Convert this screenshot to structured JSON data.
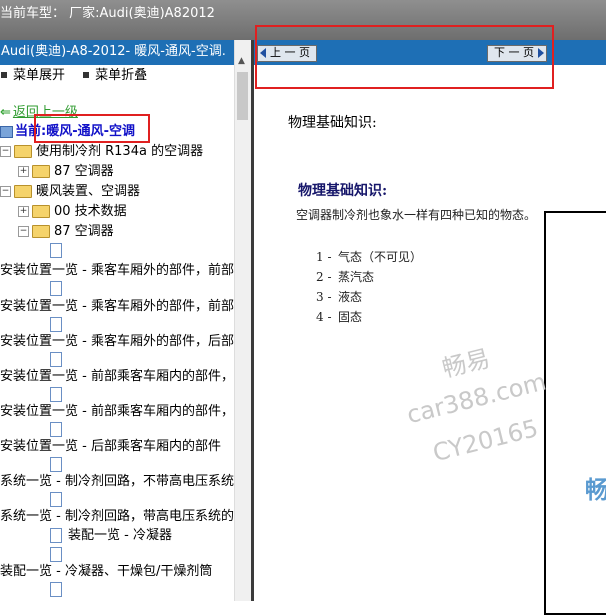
{
  "top_title": "当前车型：  厂家:Audi(奥迪)A82012",
  "left_panel": {
    "header": "Audi(奥迪)-A8-2012- 暖风-通风-空调.",
    "expand_label": "菜单展开",
    "collapse_label": "菜单折叠",
    "back_label": "返回上一级",
    "current_label": "当前:暖风-通风-空调",
    "tree": [
      {
        "label": "使用制冷剂 R134a 的空调器"
      },
      {
        "label": "87 空调器"
      },
      {
        "label": "暖风装置、空调器"
      },
      {
        "label": "00 技术数据"
      },
      {
        "label": "87 空调器"
      },
      {
        "label": "安装位置一览 - 乘客车厢外的部件，前部"
      },
      {
        "label": "安装位置一览 - 乘客车厢外的部件，前部"
      },
      {
        "label": "安装位置一览 - 乘客车厢外的部件，后部"
      },
      {
        "label": "安装位置一览 - 前部乘客车厢内的部件，"
      },
      {
        "label": "安装位置一览 - 前部乘客车厢内的部件，"
      },
      {
        "label": "安装位置一览 - 后部乘客车厢内的部件"
      },
      {
        "label": "系统一览 - 制冷剂回路，不带高电压系统"
      },
      {
        "label": "系统一览 - 制冷剂回路，带高电压系统的"
      },
      {
        "label": "装配一览 - 冷凝器"
      },
      {
        "label": "装配一览 - 冷凝器、干燥包/干燥剂筒"
      }
    ]
  },
  "nav": {
    "prev_label": "上 一 页",
    "next_label": "下 一 页"
  },
  "content": {
    "page_heading": "物理基础知识:",
    "section_heading": "物理基础知识:",
    "paragraph": "空调器制冷剂也象水一样有四种已知的物态。",
    "list": [
      {
        "num": "1 -",
        "text": "气态（不可见）"
      },
      {
        "num": "2 -",
        "text": "蒸汽态"
      },
      {
        "num": "3 -",
        "text": "液态"
      },
      {
        "num": "4 -",
        "text": "固态"
      }
    ]
  },
  "watermark": {
    "line1": "畅易",
    "line2": "car388.com",
    "line3": "CY20165"
  },
  "figure_partial_text": "畅"
}
